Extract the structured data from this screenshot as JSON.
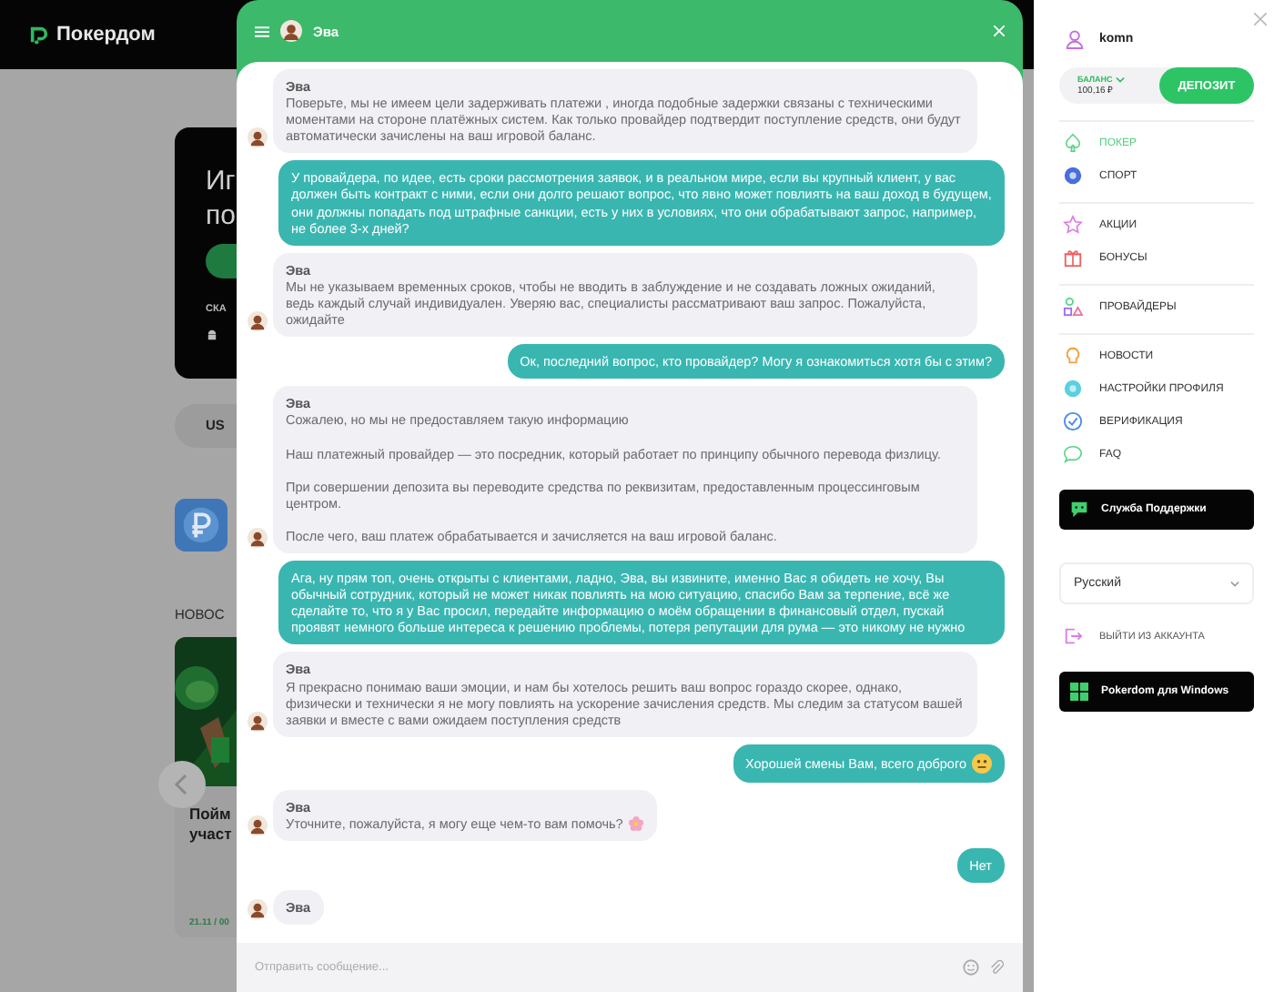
{
  "site": {
    "logo": "Покердом"
  },
  "background": {
    "promo": {
      "lines": [
        "Иг",
        "по"
      ],
      "caption": "СКА"
    },
    "currency": "US",
    "news_heading": "НОВОС",
    "news_card": {
      "title_lines": [
        "Пойм",
        "участ"
      ],
      "date": "21.11 / 00"
    }
  },
  "chat": {
    "title": "Эва",
    "placeholder": "Отправить сообщение...",
    "messages": [
      {
        "kind": "agent",
        "author": "Эва",
        "text": "Поверьте, мы не имеем цели задерживать платежи , иногда подобные задержки связаны с техническими моментами на стороне платёжных систем. Как только провайдер подтвердит поступление средств, они будут автоматически зачислены на ваш игровой баланс."
      },
      {
        "kind": "user",
        "text": "У провайдера, по идее, есть сроки рассмотрения заявок, и в реальном мире, если вы крупный клиент, у вас должен быть контракт с ними, если они долго решают вопрос, что явно может повлиять на ваш доход в будущем, они должны попадать под штрафные санкции, есть у них в условиях, что они обрабатывают запрос, например, не более 3-х дней?"
      },
      {
        "kind": "agent",
        "author": "Эва",
        "text": "Мы не указываем временных сроков, чтобы не вводить в заблуждение и не создавать ложных ожиданий, ведь каждый случай индивидуален. Уверяю вас, специалисты рассматривают ваш запрос. Пожалуйста, ожидайте"
      },
      {
        "kind": "user",
        "text": "Ок, последний вопрос, кто провайдер? Могу я ознакомиться хотя бы с этим?"
      },
      {
        "kind": "agent",
        "author": "Эва",
        "text": "Сожалею, но мы не предоставляем такую информацию\n\nНаш платежный провайдер — это посредник, который работает по принципу обычного перевода физлицу.\n\nПри совершении депозита вы переводите средства по реквизитам, предоставленным процессинговым центром.\n\nПосле чего, ваш платеж обрабатывается и зачисляется на ваш игровой баланс."
      },
      {
        "kind": "user",
        "text": "Ага, ну прям топ, очень открыты с клиентами, ладно, Эва, вы извините, именно Вас я обидеть не хочу, Вы обычный сотрудник, который не может никак повлиять на мою ситуацию, спасибо Вам за терпение, всё же сделайте то, что я у Вас просил, передайте информацию о моём обращении в финансовый отдел, пускай проявят немного больше интереса к решению проблемы, потеря репутации для рума — это никому не нужно"
      },
      {
        "kind": "agent",
        "author": "Эва",
        "text": "Я прекрасно понимаю ваши эмоции, и нам бы хотелось решить ваш вопрос гораздо скорее, однако, физически и технически я  не могу повлиять на ускорение зачисления средств. Мы следим за статусом вашей заявки и вместе с вами ожидаем поступления средств"
      },
      {
        "kind": "user",
        "text": "Хорошей смены Вам, всего доброго"
      },
      {
        "kind": "agent",
        "author": "Эва",
        "text": "Уточните, пожалуйста, я могу еще чем-то вам помочь?"
      },
      {
        "kind": "user",
        "text": "Нет"
      },
      {
        "kind": "agent",
        "author": "Эва"
      }
    ]
  },
  "sidebar": {
    "username": "komn",
    "balance_label": "БАЛАНС",
    "balance": "100,16 ₽",
    "deposit": "ДЕПОЗИТ",
    "sections": [
      {
        "items": [
          {
            "label": "ПОКЕР",
            "selected": true
          },
          {
            "label": "СПОРТ",
            "selected": false
          }
        ]
      },
      {
        "items": [
          {
            "label": "АКЦИИ",
            "selected": false
          },
          {
            "label": "БОНУСЫ",
            "selected": false
          }
        ]
      },
      {
        "items": [
          {
            "label": "ПРОВАЙДЕРЫ",
            "selected": false
          }
        ]
      },
      {
        "items": [
          {
            "label": "НОВОСТИ",
            "selected": false
          },
          {
            "label": "НАСТРОЙКИ ПРОФИЛЯ",
            "selected": false
          },
          {
            "label": "ВЕРИФИКАЦИЯ",
            "selected": false
          },
          {
            "label": "FAQ",
            "selected": false
          }
        ]
      }
    ],
    "support": "Служба Поддержки",
    "language": "Русский",
    "logout": "ВЫЙТИ ИЗ АККАУНТА",
    "windows_app": "Pokerdom для Windows"
  }
}
